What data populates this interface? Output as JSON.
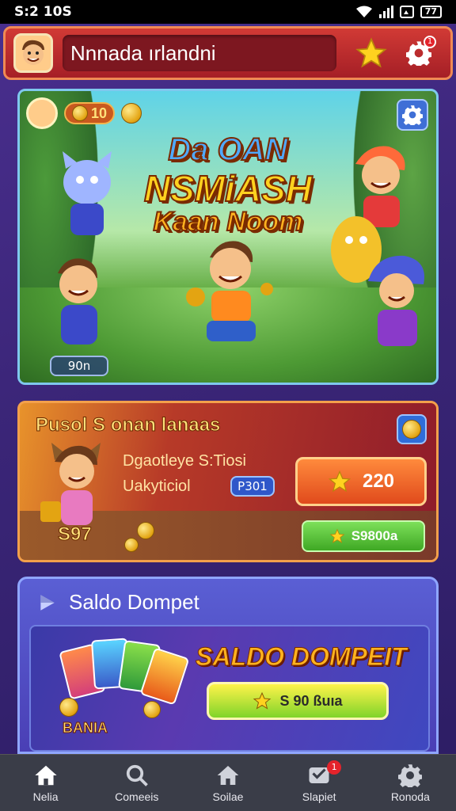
{
  "status_bar": {
    "time": "S:2 10S",
    "battery": "77"
  },
  "header": {
    "search_text": "Nnnada ırlandni",
    "notification_count": "1",
    "icons": [
      "avatar",
      "star-icon",
      "gear-icon"
    ]
  },
  "hero": {
    "coin_count": "10",
    "logo_line1": "Da  OAN",
    "logo_line2": "NSMiASH",
    "logo_line3": "Kaan Noom",
    "counter": "90n"
  },
  "offer": {
    "title": "Pusol S onan lanaas",
    "line1": "Dgaotleye S:Tiosi",
    "line2": "Uakyticiol",
    "badge": "P301",
    "price": "220",
    "cash": "S97",
    "buy_label": "S9800a"
  },
  "wallet": {
    "title": "Saldo Dompet",
    "headline": "SALDO DOMPEIT",
    "button_label": "S 90 ßuıa",
    "brand": "BANIA"
  },
  "nav": {
    "items": [
      {
        "label": "Nelia",
        "icon": "home-icon"
      },
      {
        "label": "Comeeis",
        "icon": "search-icon"
      },
      {
        "label": "Soilae",
        "icon": "house-icon"
      },
      {
        "label": "Slapiet",
        "icon": "inbox-icon",
        "badge": "1"
      },
      {
        "label": "Ronoda",
        "icon": "gear-icon"
      }
    ]
  },
  "colors": {
    "brand_red": "#c9302c",
    "accent_orange": "#e8932b",
    "wallet_blue": "#5a5fd4",
    "nav_bg": "#3a3d48"
  }
}
